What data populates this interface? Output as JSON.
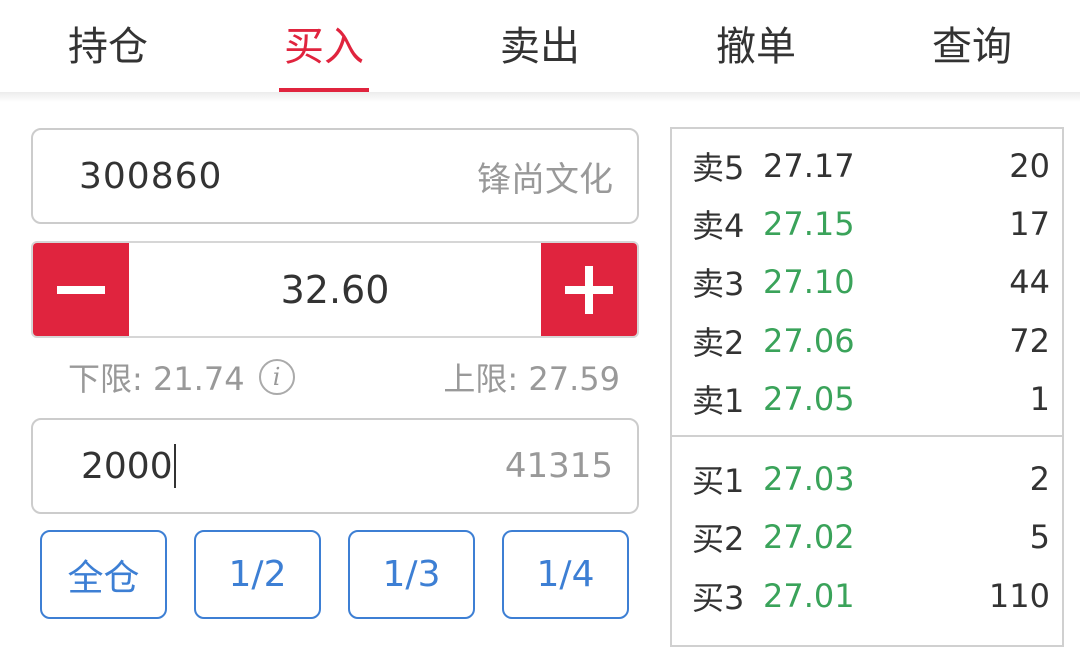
{
  "tabs": [
    "持仓",
    "买入",
    "卖出",
    "撤单",
    "查询"
  ],
  "active_tab": "买入",
  "stock": {
    "code": "300860",
    "name": "锋尚文化"
  },
  "price": {
    "value": "32.60",
    "minus_icon": "minus-icon",
    "plus_icon": "plus-icon"
  },
  "limits": {
    "lower": "下限: 21.74",
    "upper": "上限: 27.59",
    "info_icon": "info-icon"
  },
  "quantity": {
    "value": "2000",
    "max": "41315"
  },
  "ratio_buttons": [
    "全仓",
    "1/2",
    "1/3",
    "1/4"
  ],
  "colors": {
    "accent": "#e0243e",
    "blue": "#3d7fd4",
    "green": "#3aa35a"
  },
  "order_book": {
    "asks": [
      {
        "label": "卖5",
        "price": "27.17",
        "volume": "20",
        "color": "#333333"
      },
      {
        "label": "卖4",
        "price": "27.15",
        "volume": "17",
        "color": "#3aa35a"
      },
      {
        "label": "卖3",
        "price": "27.10",
        "volume": "44",
        "color": "#3aa35a"
      },
      {
        "label": "卖2",
        "price": "27.06",
        "volume": "72",
        "color": "#3aa35a"
      },
      {
        "label": "卖1",
        "price": "27.05",
        "volume": "1",
        "color": "#3aa35a"
      }
    ],
    "bids": [
      {
        "label": "买1",
        "price": "27.03",
        "volume": "2",
        "color": "#3aa35a"
      },
      {
        "label": "买2",
        "price": "27.02",
        "volume": "5",
        "color": "#3aa35a"
      },
      {
        "label": "买3",
        "price": "27.01",
        "volume": "110",
        "color": "#3aa35a"
      }
    ]
  }
}
